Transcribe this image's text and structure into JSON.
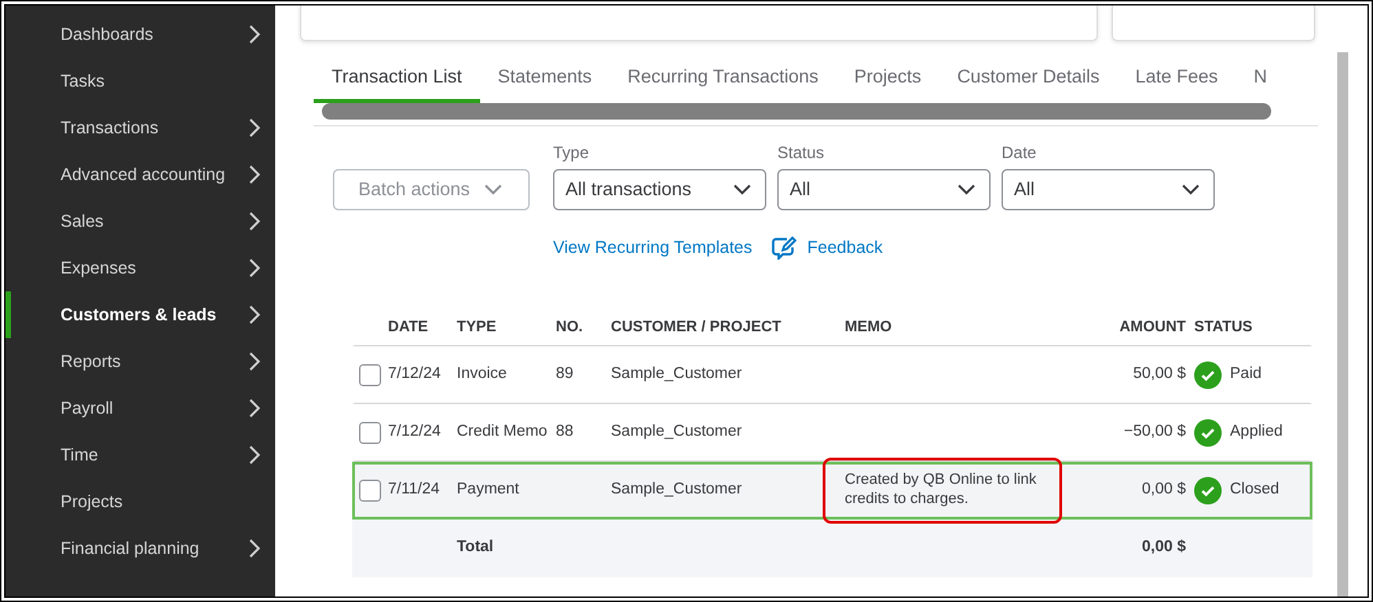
{
  "sidebar": {
    "items": [
      {
        "label": "Dashboards",
        "expandable": true,
        "selected": false
      },
      {
        "label": "Tasks",
        "expandable": false,
        "selected": false
      },
      {
        "label": "Transactions",
        "expandable": true,
        "selected": false
      },
      {
        "label": "Advanced accounting",
        "expandable": true,
        "selected": false
      },
      {
        "label": "Sales",
        "expandable": true,
        "selected": false
      },
      {
        "label": "Expenses",
        "expandable": true,
        "selected": false
      },
      {
        "label": "Customers & leads",
        "expandable": true,
        "selected": true
      },
      {
        "label": "Reports",
        "expandable": true,
        "selected": false
      },
      {
        "label": "Payroll",
        "expandable": true,
        "selected": false
      },
      {
        "label": "Time",
        "expandable": true,
        "selected": false
      },
      {
        "label": "Projects",
        "expandable": false,
        "selected": false
      },
      {
        "label": "Financial planning",
        "expandable": true,
        "selected": false
      }
    ]
  },
  "tabs": [
    {
      "label": "Transaction List",
      "selected": true
    },
    {
      "label": "Statements",
      "selected": false
    },
    {
      "label": "Recurring Transactions",
      "selected": false
    },
    {
      "label": "Projects",
      "selected": false
    },
    {
      "label": "Customer Details",
      "selected": false
    },
    {
      "label": "Late Fees",
      "selected": false
    },
    {
      "label": "N",
      "selected": false
    }
  ],
  "batch_actions": {
    "label": "Batch actions",
    "disabled": true
  },
  "filters": [
    {
      "label": "Type",
      "value": "All transactions"
    },
    {
      "label": "Status",
      "value": "All"
    },
    {
      "label": "Date",
      "value": "All"
    }
  ],
  "links": [
    {
      "label": "View Recurring Templates",
      "kind": "text"
    },
    {
      "label": "Feedback",
      "kind": "feedback"
    }
  ],
  "table": {
    "columns": [
      "DATE",
      "TYPE",
      "NO.",
      "CUSTOMER / PROJECT",
      "MEMO",
      "AMOUNT",
      "STATUS"
    ],
    "rows": [
      {
        "checked": false,
        "selected": false,
        "date": "7/12/24",
        "type": "Invoice",
        "no": "89",
        "customer": "Sample_Customer",
        "memo": "",
        "memo_highlighted": false,
        "amount": "50,00 $",
        "status": "Paid"
      },
      {
        "checked": false,
        "selected": false,
        "date": "7/12/24",
        "type": "Credit Memo",
        "no": "88",
        "customer": "Sample_Customer",
        "memo": "",
        "memo_highlighted": false,
        "amount": "−50,00 $",
        "status": "Applied"
      },
      {
        "checked": false,
        "selected": true,
        "date": "7/11/24",
        "type": "Payment",
        "no": "",
        "customer": "Sample_Customer",
        "memo": "Created by QB Online to link credits to charges.",
        "memo_highlighted": true,
        "amount": "0,00 $",
        "status": "Closed"
      }
    ],
    "total": {
      "label": "Total",
      "amount": "0,00 $"
    }
  }
}
